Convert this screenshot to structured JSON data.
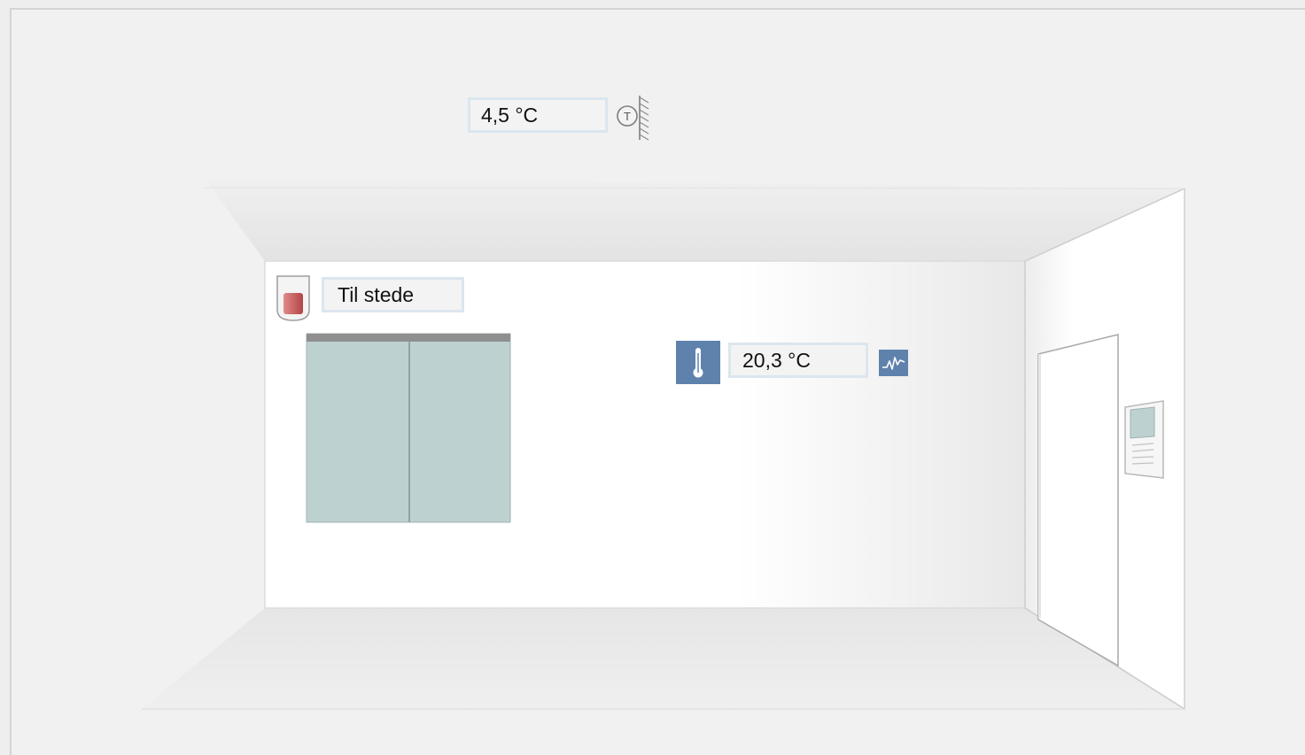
{
  "outdoor": {
    "temperature": "4,5 °C",
    "icon": "outdoor-temperature-sensor-icon"
  },
  "room": {
    "presence_status": "Til stede",
    "presence_icon": "presence-detector-icon",
    "indoor_temperature": "20,3 °C",
    "thermometer_icon": "thermometer-icon",
    "trend_icon": "trend-chart-icon",
    "room_unit_icon": "room-operator-unit-icon"
  },
  "colors": {
    "accent": "#5f82ad",
    "field_border": "#dbe6ef",
    "window_glass": "#bdd2d0",
    "presence_red": "#c65b5b"
  }
}
